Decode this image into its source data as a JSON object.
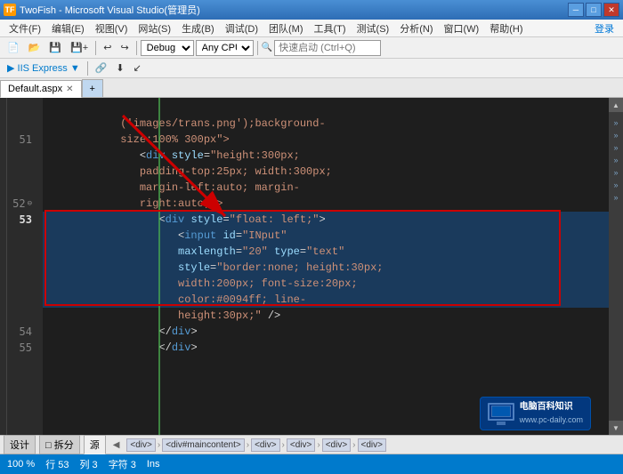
{
  "titleBar": {
    "icon": "TF",
    "title": "TwoFish - Microsoft Visual Studio(管理员)",
    "windowControls": {
      "minimize": "─",
      "maximize": "□",
      "close": "✕"
    }
  },
  "menuBar": {
    "items": [
      "文件(F)",
      "编辑(E)",
      "视图(V)",
      "网站(S)",
      "生成(B)",
      "调试(D)",
      "团队(M)",
      "工具(T)",
      "测试(S)",
      "分析(N)",
      "窗口(W)",
      "帮助(H)",
      "登录"
    ]
  },
  "toolbar": {
    "quickSearch": "快速启动 (Ctrl+Q)",
    "debugMode": "Debug",
    "cpuMode": "Any CPU",
    "undoLabel": "↩",
    "redoLabel": "↪"
  },
  "tabBar": {
    "tabs": [
      {
        "name": "Default.aspx",
        "active": true
      },
      {
        "name": "+",
        "active": false
      }
    ]
  },
  "codeLines": [
    {
      "num": "",
      "content": "   ('images/trans.png');background-",
      "indent": 0
    },
    {
      "num": "",
      "content": "   size:100% 300px\">",
      "indent": 0
    },
    {
      "num": "51",
      "content": "      <div style=\"height:300px;",
      "indent": 0
    },
    {
      "num": "",
      "content": "      padding-top:25px; width:300px;",
      "indent": 0
    },
    {
      "num": "",
      "content": "      margin-left:auto; margin-",
      "indent": 0
    },
    {
      "num": "",
      "content": "      right:auto;\">",
      "indent": 0
    },
    {
      "num": "52",
      "content": "         <div style=\"float: left;\">",
      "indent": 0
    },
    {
      "num": "53",
      "content": "            <input id=\"INput\"",
      "indent": 0,
      "highlighted": true
    },
    {
      "num": "",
      "content": "            maxlength=\"20\" type=\"text\"",
      "indent": 0,
      "highlighted": true
    },
    {
      "num": "",
      "content": "            style=\"border:none; height:30px;",
      "indent": 0,
      "highlighted": true
    },
    {
      "num": "",
      "content": "            width:200px; font-size:20px;",
      "indent": 0,
      "highlighted": true
    },
    {
      "num": "",
      "content": "            color:#0094ff; line-",
      "indent": 0,
      "highlighted": true
    },
    {
      "num": "",
      "content": "            height:30px;\" />",
      "indent": 0,
      "highlighted": true
    },
    {
      "num": "54",
      "content": "         </div>",
      "indent": 0
    },
    {
      "num": "55",
      "content": "         </div>",
      "indent": 0
    }
  ],
  "bottomToolbar": {
    "viewTabs": [
      "设计",
      "□ 拆分",
      "源"
    ],
    "activeTab": "源"
  },
  "breadcrumb": {
    "items": [
      "<div>",
      "<div#maincontent>",
      "<div>",
      "<div>",
      "<div>",
      "<div>"
    ]
  },
  "statusBar": {
    "zoom": "100 %",
    "row": "行 53",
    "col": "列 3",
    "char": "字符 3",
    "mode": "Ins"
  },
  "logo": {
    "site": "电脑百科知识",
    "url": "www.pc-daily.com"
  }
}
